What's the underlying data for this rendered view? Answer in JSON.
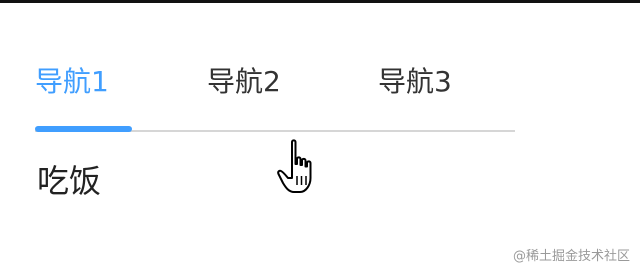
{
  "tabs": [
    {
      "label": "导航1",
      "active": true
    },
    {
      "label": "导航2",
      "active": false
    },
    {
      "label": "导航3",
      "active": false
    }
  ],
  "content": {
    "text": "吃饭"
  },
  "watermark": {
    "text": "@稀土掘金技术社区"
  },
  "colors": {
    "accent": "#409eff",
    "text": "#333333"
  },
  "cursor_icon": "hand-pointer-icon"
}
